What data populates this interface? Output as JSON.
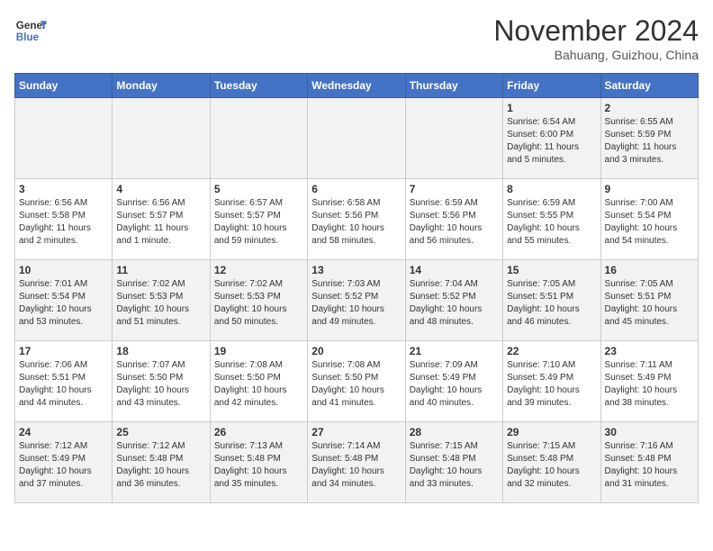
{
  "header": {
    "logo_line1": "General",
    "logo_line2": "Blue",
    "month": "November 2024",
    "location": "Bahuang, Guizhou, China"
  },
  "weekdays": [
    "Sunday",
    "Monday",
    "Tuesday",
    "Wednesday",
    "Thursday",
    "Friday",
    "Saturday"
  ],
  "weeks": [
    [
      {
        "day": "",
        "info": ""
      },
      {
        "day": "",
        "info": ""
      },
      {
        "day": "",
        "info": ""
      },
      {
        "day": "",
        "info": ""
      },
      {
        "day": "",
        "info": ""
      },
      {
        "day": "1",
        "info": "Sunrise: 6:54 AM\nSunset: 6:00 PM\nDaylight: 11 hours\nand 5 minutes."
      },
      {
        "day": "2",
        "info": "Sunrise: 6:55 AM\nSunset: 5:59 PM\nDaylight: 11 hours\nand 3 minutes."
      }
    ],
    [
      {
        "day": "3",
        "info": "Sunrise: 6:56 AM\nSunset: 5:58 PM\nDaylight: 11 hours\nand 2 minutes."
      },
      {
        "day": "4",
        "info": "Sunrise: 6:56 AM\nSunset: 5:57 PM\nDaylight: 11 hours\nand 1 minute."
      },
      {
        "day": "5",
        "info": "Sunrise: 6:57 AM\nSunset: 5:57 PM\nDaylight: 10 hours\nand 59 minutes."
      },
      {
        "day": "6",
        "info": "Sunrise: 6:58 AM\nSunset: 5:56 PM\nDaylight: 10 hours\nand 58 minutes."
      },
      {
        "day": "7",
        "info": "Sunrise: 6:59 AM\nSunset: 5:56 PM\nDaylight: 10 hours\nand 56 minutes."
      },
      {
        "day": "8",
        "info": "Sunrise: 6:59 AM\nSunset: 5:55 PM\nDaylight: 10 hours\nand 55 minutes."
      },
      {
        "day": "9",
        "info": "Sunrise: 7:00 AM\nSunset: 5:54 PM\nDaylight: 10 hours\nand 54 minutes."
      }
    ],
    [
      {
        "day": "10",
        "info": "Sunrise: 7:01 AM\nSunset: 5:54 PM\nDaylight: 10 hours\nand 53 minutes."
      },
      {
        "day": "11",
        "info": "Sunrise: 7:02 AM\nSunset: 5:53 PM\nDaylight: 10 hours\nand 51 minutes."
      },
      {
        "day": "12",
        "info": "Sunrise: 7:02 AM\nSunset: 5:53 PM\nDaylight: 10 hours\nand 50 minutes."
      },
      {
        "day": "13",
        "info": "Sunrise: 7:03 AM\nSunset: 5:52 PM\nDaylight: 10 hours\nand 49 minutes."
      },
      {
        "day": "14",
        "info": "Sunrise: 7:04 AM\nSunset: 5:52 PM\nDaylight: 10 hours\nand 48 minutes."
      },
      {
        "day": "15",
        "info": "Sunrise: 7:05 AM\nSunset: 5:51 PM\nDaylight: 10 hours\nand 46 minutes."
      },
      {
        "day": "16",
        "info": "Sunrise: 7:05 AM\nSunset: 5:51 PM\nDaylight: 10 hours\nand 45 minutes."
      }
    ],
    [
      {
        "day": "17",
        "info": "Sunrise: 7:06 AM\nSunset: 5:51 PM\nDaylight: 10 hours\nand 44 minutes."
      },
      {
        "day": "18",
        "info": "Sunrise: 7:07 AM\nSunset: 5:50 PM\nDaylight: 10 hours\nand 43 minutes."
      },
      {
        "day": "19",
        "info": "Sunrise: 7:08 AM\nSunset: 5:50 PM\nDaylight: 10 hours\nand 42 minutes."
      },
      {
        "day": "20",
        "info": "Sunrise: 7:08 AM\nSunset: 5:50 PM\nDaylight: 10 hours\nand 41 minutes."
      },
      {
        "day": "21",
        "info": "Sunrise: 7:09 AM\nSunset: 5:49 PM\nDaylight: 10 hours\nand 40 minutes."
      },
      {
        "day": "22",
        "info": "Sunrise: 7:10 AM\nSunset: 5:49 PM\nDaylight: 10 hours\nand 39 minutes."
      },
      {
        "day": "23",
        "info": "Sunrise: 7:11 AM\nSunset: 5:49 PM\nDaylight: 10 hours\nand 38 minutes."
      }
    ],
    [
      {
        "day": "24",
        "info": "Sunrise: 7:12 AM\nSunset: 5:49 PM\nDaylight: 10 hours\nand 37 minutes."
      },
      {
        "day": "25",
        "info": "Sunrise: 7:12 AM\nSunset: 5:48 PM\nDaylight: 10 hours\nand 36 minutes."
      },
      {
        "day": "26",
        "info": "Sunrise: 7:13 AM\nSunset: 5:48 PM\nDaylight: 10 hours\nand 35 minutes."
      },
      {
        "day": "27",
        "info": "Sunrise: 7:14 AM\nSunset: 5:48 PM\nDaylight: 10 hours\nand 34 minutes."
      },
      {
        "day": "28",
        "info": "Sunrise: 7:15 AM\nSunset: 5:48 PM\nDaylight: 10 hours\nand 33 minutes."
      },
      {
        "day": "29",
        "info": "Sunrise: 7:15 AM\nSunset: 5:48 PM\nDaylight: 10 hours\nand 32 minutes."
      },
      {
        "day": "30",
        "info": "Sunrise: 7:16 AM\nSunset: 5:48 PM\nDaylight: 10 hours\nand 31 minutes."
      }
    ]
  ]
}
